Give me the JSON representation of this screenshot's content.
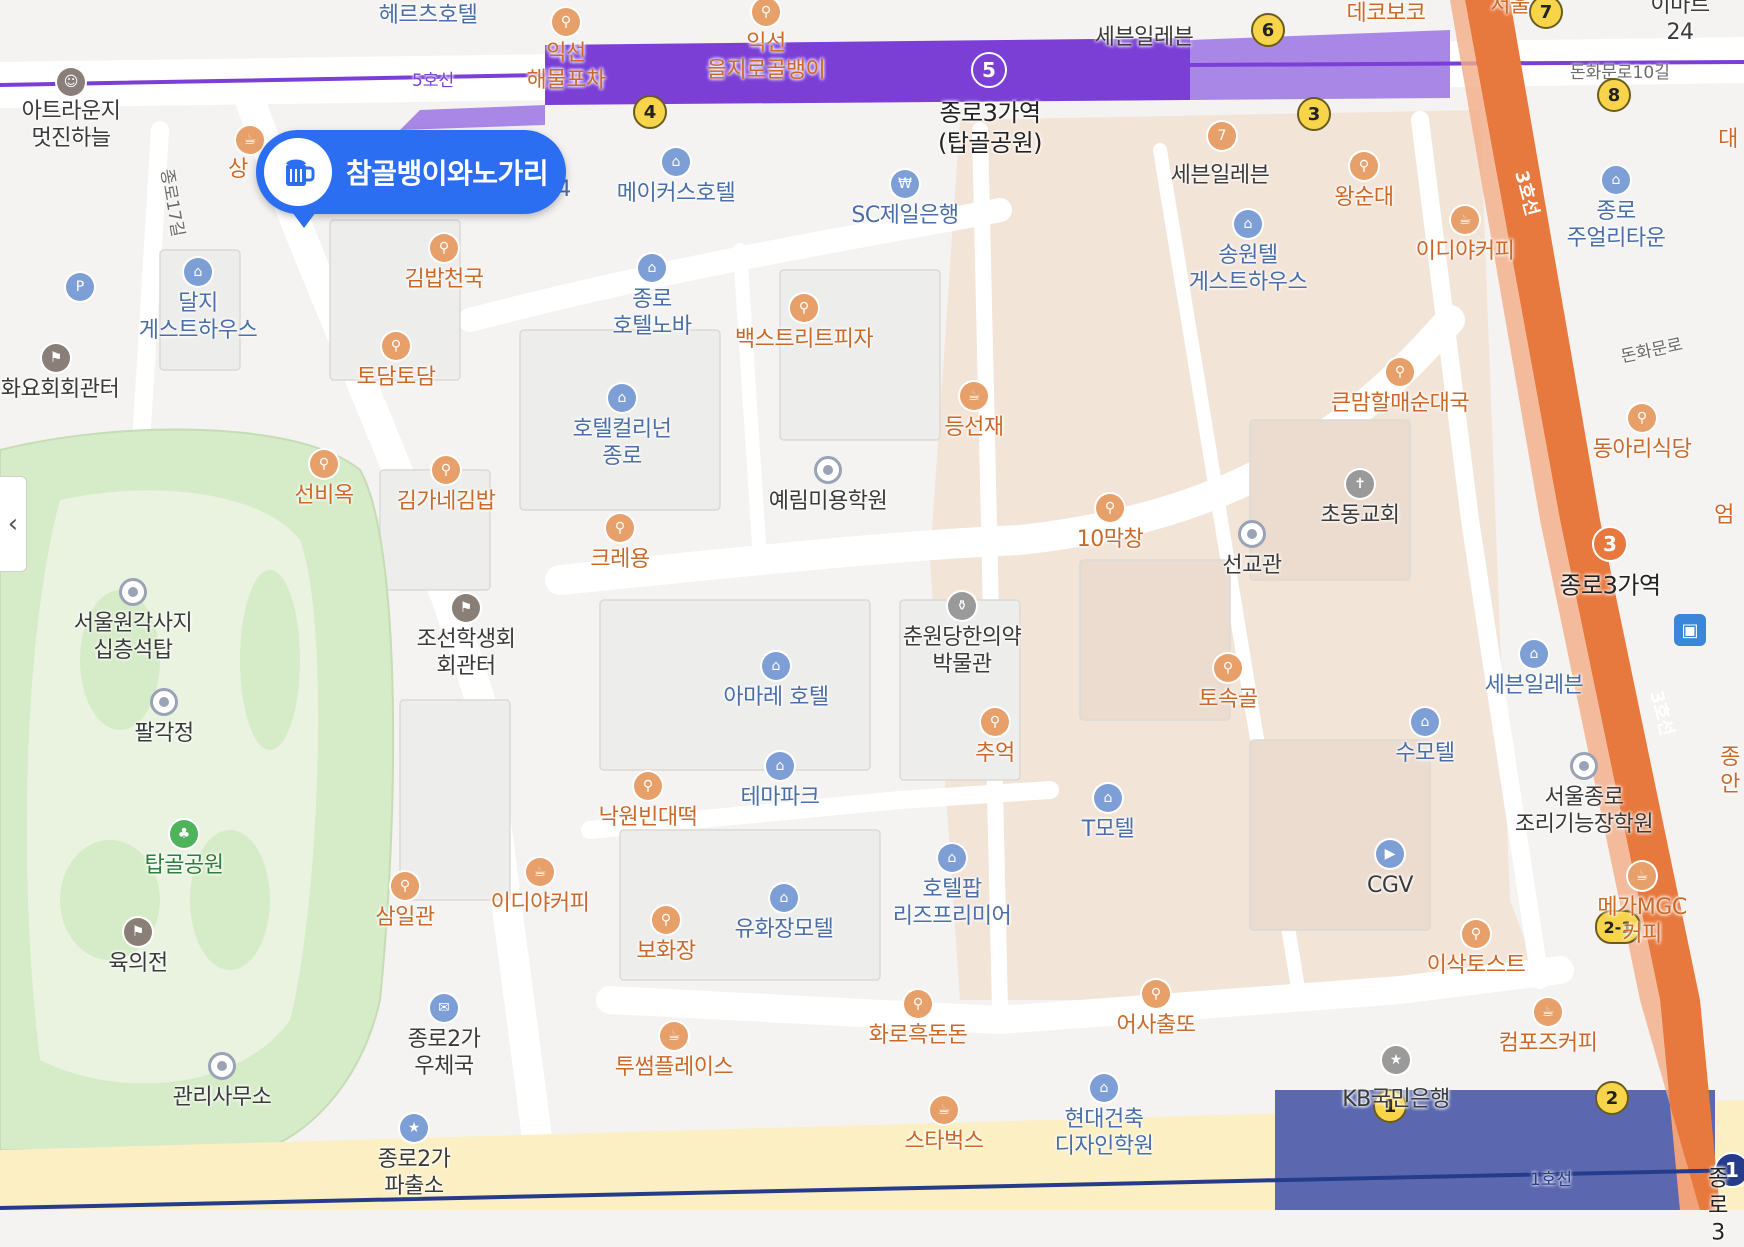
{
  "colors": {
    "line5": "#7b3fd6",
    "line3": "#e8793e",
    "line1": "#263c8a",
    "park": "#d6ebc7",
    "callout": "#2c6ef2"
  },
  "callout": {
    "label": "참골뱅이와노가리",
    "icon": "beer-mug-icon"
  },
  "stations": {
    "jongno3_line5": {
      "name": "종로3가역\n(탑골공원)",
      "line": "5"
    },
    "jongno3_line3": {
      "name": "종로3가역",
      "line": "3"
    },
    "line1_badge": "1",
    "jongno_cut": "종로3"
  },
  "rail_labels": {
    "line5": "5호선",
    "line3a": "3호선",
    "line3b": "3호선",
    "line1": "1호선"
  },
  "road_labels": {
    "jongno17": "종로17길",
    "donhwamun10": "돈화문로10길",
    "donhwamun": "돈화문로"
  },
  "exits": [
    "4",
    "3",
    "6",
    "7",
    "8",
    "2-1",
    "1",
    "2"
  ],
  "pois": [
    {
      "id": "hertz",
      "text": "헤르츠호텔",
      "cls": "c-hotel"
    },
    {
      "id": "iksun1",
      "text": "익선\n해물포차",
      "cls": "c-food"
    },
    {
      "id": "iksun2",
      "text": "익선\n을지로골뱅이",
      "cls": "c-food"
    },
    {
      "id": "seven1",
      "text": "세븐일레븐",
      "cls": "c-place"
    },
    {
      "id": "decoboco",
      "text": "데코보코",
      "cls": "c-food"
    },
    {
      "id": "seoul_cut",
      "text": "서울",
      "cls": "c-food"
    },
    {
      "id": "emart",
      "text": "이마트24",
      "cls": "c-place"
    },
    {
      "id": "artlounge",
      "text": "아트라운지\n멋진하늘",
      "cls": "c-place"
    },
    {
      "id": "sang",
      "text": "상",
      "cls": "c-food"
    },
    {
      "id": "makers",
      "text": "메이커스호텔",
      "cls": "c-hotel"
    },
    {
      "id": "sc",
      "text": "SC제일은행",
      "cls": "c-bank"
    },
    {
      "id": "seven2",
      "text": "세븐일레븐",
      "cls": "c-place"
    },
    {
      "id": "wangsun",
      "text": "왕순대",
      "cls": "c-food"
    },
    {
      "id": "ediya1",
      "text": "이디야커피",
      "cls": "c-cafe"
    },
    {
      "id": "jewelry",
      "text": "종로\n주얼리타운",
      "cls": "c-hotel"
    },
    {
      "id": "dalji",
      "text": "달지\n게스트하우스",
      "cls": "c-hotel"
    },
    {
      "id": "gimbap",
      "text": "김밥천국",
      "cls": "c-food"
    },
    {
      "id": "hotelnova",
      "text": "종로\n호텔노바",
      "cls": "c-hotel"
    },
    {
      "id": "songwon",
      "text": "송원텔\n게스트하우스",
      "cls": "c-hotel"
    },
    {
      "id": "hwayo",
      "text": "화요회회관터",
      "cls": "c-place"
    },
    {
      "id": "todam",
      "text": "토담토담",
      "cls": "c-food"
    },
    {
      "id": "backstreet",
      "text": "백스트리트피자",
      "cls": "c-food"
    },
    {
      "id": "keunmam",
      "text": "큰맘할매순대국",
      "cls": "c-food"
    },
    {
      "id": "colleenen",
      "text": "호텔컬리넌\n종로",
      "cls": "c-hotel"
    },
    {
      "id": "deungsun",
      "text": "등선재",
      "cls": "c-cafe"
    },
    {
      "id": "dongari",
      "text": "동아리식당",
      "cls": "c-food"
    },
    {
      "id": "seonbiok",
      "text": "선비옥",
      "cls": "c-food"
    },
    {
      "id": "gimga",
      "text": "김가네김밥",
      "cls": "c-food"
    },
    {
      "id": "yerim",
      "text": "예림미용학원",
      "cls": "c-place"
    },
    {
      "id": "makchang",
      "text": "10막창",
      "cls": "c-food"
    },
    {
      "id": "chodong",
      "text": "초동교회",
      "cls": "c-place"
    },
    {
      "id": "eom",
      "text": "엄",
      "cls": "c-food"
    },
    {
      "id": "seongyo",
      "text": "선교관",
      "cls": "c-place"
    },
    {
      "id": "kreyong",
      "text": "크레용",
      "cls": "c-food"
    },
    {
      "id": "wongak",
      "text": "서울원각사지\n십층석탑",
      "cls": "c-place"
    },
    {
      "id": "joseon",
      "text": "조선학생회\n회관터",
      "cls": "c-place"
    },
    {
      "id": "chunwon",
      "text": "춘원당한의약\n박물관",
      "cls": "c-place"
    },
    {
      "id": "amare",
      "text": "아마레 호텔",
      "cls": "c-hotel"
    },
    {
      "id": "tosok",
      "text": "토속골",
      "cls": "c-food"
    },
    {
      "id": "seven3",
      "text": "세븐일레븐",
      "cls": "c-hotel"
    },
    {
      "id": "palgak",
      "text": "팔각정",
      "cls": "c-place"
    },
    {
      "id": "chueok",
      "text": "추억",
      "cls": "c-food"
    },
    {
      "id": "sumotel",
      "text": "수모텔",
      "cls": "c-hotel"
    },
    {
      "id": "jong_cut",
      "text": "종\n안",
      "cls": "c-food"
    },
    {
      "id": "nakwon",
      "text": "낙원빈대떡",
      "cls": "c-food"
    },
    {
      "id": "themapark",
      "text": "테마파크",
      "cls": "c-hotel"
    },
    {
      "id": "tmotel",
      "text": "T모텔",
      "cls": "c-hotel"
    },
    {
      "id": "cooking",
      "text": "서울종로\n조리기능장학원",
      "cls": "c-place"
    },
    {
      "id": "tapgol",
      "text": "탑골공원",
      "cls": "c-green"
    },
    {
      "id": "samil",
      "text": "삼일관",
      "cls": "c-food"
    },
    {
      "id": "ediya2",
      "text": "이디야커피",
      "cls": "c-cafe"
    },
    {
      "id": "hotelpop",
      "text": "호텔팝\n리즈프리미어",
      "cls": "c-hotel"
    },
    {
      "id": "cgv",
      "text": "CGV",
      "cls": "c-place"
    },
    {
      "id": "mega",
      "text": "메가MGC커피",
      "cls": "c-cafe"
    },
    {
      "id": "yukui",
      "text": "육의전",
      "cls": "c-place"
    },
    {
      "id": "bohwa",
      "text": "보화장",
      "cls": "c-food"
    },
    {
      "id": "yuhwa",
      "text": "유화장모텔",
      "cls": "c-hotel"
    },
    {
      "id": "isaac",
      "text": "이삭토스트",
      "cls": "c-food"
    },
    {
      "id": "post",
      "text": "종로2가\n우체국",
      "cls": "c-place"
    },
    {
      "id": "hwaro",
      "text": "화로흑돈돈",
      "cls": "c-food"
    },
    {
      "id": "eosa",
      "text": "어사출또",
      "cls": "c-food"
    },
    {
      "id": "compose",
      "text": "컴포즈커피",
      "cls": "c-cafe"
    },
    {
      "id": "office",
      "text": "관리사무소",
      "cls": "c-place"
    },
    {
      "id": "twosome",
      "text": "투썸플레이스",
      "cls": "c-cafe"
    },
    {
      "id": "kb",
      "text": "KB국민은행",
      "cls": "c-place"
    },
    {
      "id": "starbucks",
      "text": "스타벅스",
      "cls": "c-cafe"
    },
    {
      "id": "hyundai",
      "text": "현대건축\n디자인학원",
      "cls": "c-hotel"
    },
    {
      "id": "police",
      "text": "종로2가\n파출소",
      "cls": "c-place"
    },
    {
      "id": "four",
      "text": "4",
      "cls": "c-hotel"
    },
    {
      "id": "daeg",
      "text": "대",
      "cls": "c-food"
    }
  ]
}
